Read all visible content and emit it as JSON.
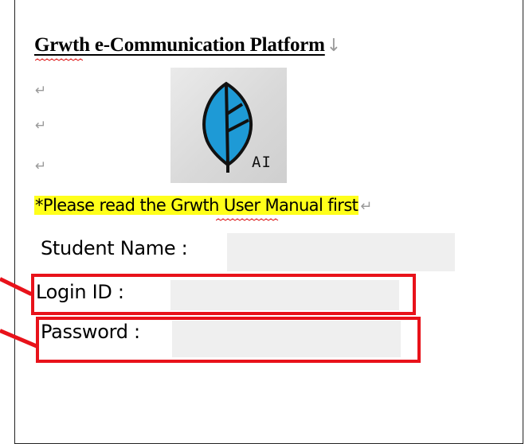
{
  "document": {
    "title": "Grwth e-Communication Platform",
    "paragraph_mark": "↓",
    "return_mark": "↵",
    "logo_text": "AI",
    "notice": "*Please read the Grwth User Manual first",
    "fields": [
      {
        "label": "Student Name :",
        "value": ""
      },
      {
        "label": "Login ID   :",
        "value": ""
      },
      {
        "label": "Password :",
        "value": ""
      }
    ]
  },
  "colors": {
    "highlight": "#ffff1a",
    "annotation_red": "#e8121a",
    "field_shading": "#efefef",
    "logo_leaf": "#1e9ad6"
  }
}
